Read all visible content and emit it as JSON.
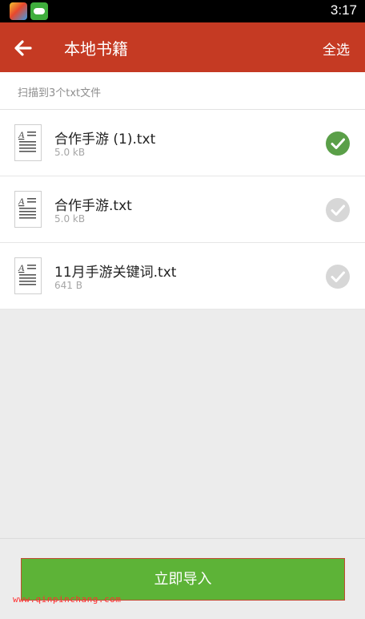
{
  "status_bar": {
    "time": "3:17",
    "apps": [
      "colorful-app-icon",
      "game-controller-app-icon"
    ]
  },
  "appbar": {
    "title": "本地书籍",
    "select_all_label": "全选",
    "back_icon": "arrow-left-icon",
    "color": "#c53a23"
  },
  "scan": {
    "text": "扫描到3个txt文件"
  },
  "files": [
    {
      "name": "合作手游 (1).txt",
      "size": "5.0 kB",
      "selected": true
    },
    {
      "name": "合作手游.txt",
      "size": "5.0 kB",
      "selected": false
    },
    {
      "name": "11月手游关键词.txt",
      "size": "641 B",
      "selected": false
    }
  ],
  "bottom": {
    "import_label": "立即导入",
    "button_color": "#5db337"
  },
  "watermark": "www.qinpinchang.com",
  "colors": {
    "check_selected": "#5a9f48",
    "check_unselected": "#d7d7d7"
  }
}
